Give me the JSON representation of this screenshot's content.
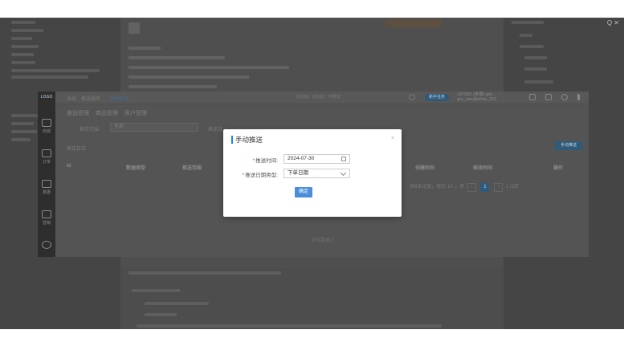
{
  "window": {
    "controls": "Q  ✕"
  },
  "breadcrumb": [
    "系统",
    "推送服务",
    "手动推送"
  ],
  "header": {
    "search_placeholder": "搜页面、搜功能、搜菜单",
    "pill_label": "新手任务",
    "user_line1": "147053 (伊莱)-gm..",
    "user_line2": "gm_yan@niina_333"
  },
  "sidebar": [
    {
      "label": "商城"
    },
    {
      "label": "订单"
    },
    {
      "label": "数据"
    },
    {
      "label": "营销"
    }
  ],
  "tabs": [
    "推送管理",
    "商品管理",
    "客户管理"
  ],
  "filter": {
    "scope_label": "推送范围",
    "scope_value": "全部",
    "range_label": "推送日"
  },
  "list": {
    "title": "推送日志",
    "add_button": "手动推送",
    "columns": [
      "Id",
      "数据类型",
      "推送范围",
      "创建时间",
      "修改时间",
      "操作"
    ],
    "empty": "没有数据了"
  },
  "pager": {
    "summary": "共8条记录，每页",
    "page_size": "10",
    "page_unit": "条",
    "current": "1",
    "jump": "1",
    "total": "/1页"
  },
  "modal": {
    "title": "手动推送",
    "close": "×",
    "date_label": "推送时间:",
    "date_value": "2024-07-30",
    "type_label": "推送日期类型:",
    "type_value": "下单日期",
    "confirm": "确定"
  }
}
